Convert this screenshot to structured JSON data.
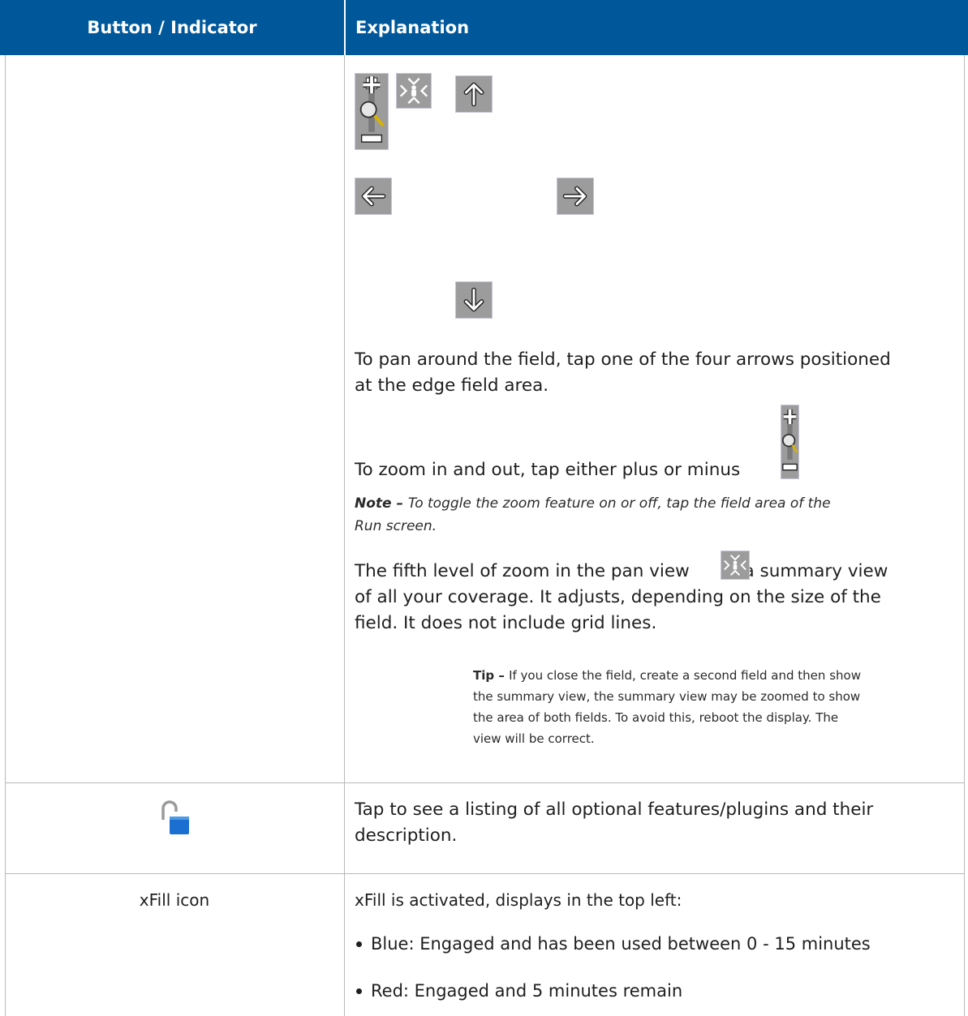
{
  "header": {
    "col1": "Button / Indicator",
    "col2": "Explanation"
  },
  "colors": {
    "header_bg": "#00589a",
    "border": "#b9b9b9",
    "button_gray": "#9c9c9c",
    "lock_blue": "#1a6fd0",
    "magnifier_yellow": "#d8b200"
  },
  "row1": {
    "icons": [
      "zoom-slider-icon",
      "pan-summary-icon",
      "arrow-up-icon",
      "arrow-left-icon",
      "arrow-right-icon",
      "arrow-down-icon"
    ],
    "pan_text_1": "To pan around the field, tap one of the four arrows positioned",
    "pan_text_2": "at the edge field area.",
    "zoom_text": "To zoom in and out, tap either plus or minus",
    "note_label": "Note",
    "note_dash": " – ",
    "note_text_1": "To toggle the zoom feature on or off, tap the field area of the",
    "note_text_2": "Run screen.",
    "fifth_1a": "The fifth level of zoom in the pan view",
    "fifth_1b": " is a summary view",
    "fifth_2": "of all your coverage. It adjusts, depending on the size of the",
    "fifth_3": "field. It does not include grid lines.",
    "tip_label": "Tip",
    "tip_dash": " – ",
    "tip_1": "If you close the field, create a second field and then show",
    "tip_2": "the summary view, the summary view may be zoomed to show",
    "tip_3": "the area of both fields. To avoid this, reboot the display. The",
    "tip_4": "view will be correct."
  },
  "row2": {
    "icon": "unlock-icon",
    "text_1": "Tap to see a listing of all optional features/plugins and their",
    "text_2": "description."
  },
  "row3": {
    "label": "xFill icon",
    "intro": "xFill is activated, displays in the top left:",
    "bullets": [
      "Blue: Engaged and has been used between 0 - 15 minutes",
      "Red: Engaged and 5 minutes remain"
    ]
  }
}
